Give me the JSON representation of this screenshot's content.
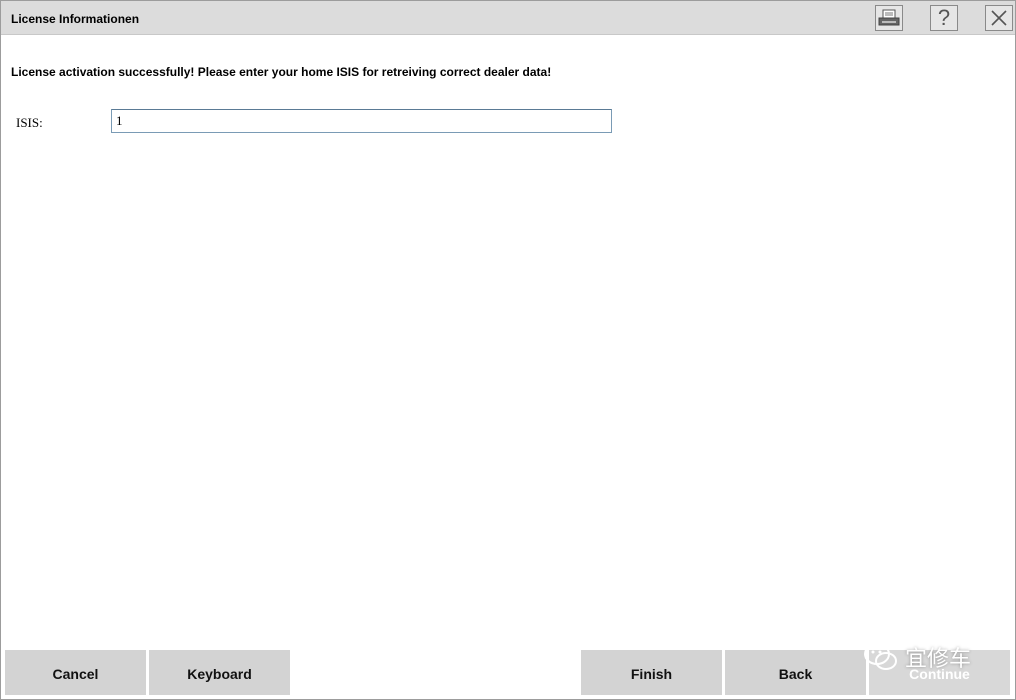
{
  "window": {
    "title": "License Informationen",
    "icons": {
      "print": "printer-icon",
      "help": "help-icon",
      "close": "close-icon"
    },
    "help_glyph": "?"
  },
  "main": {
    "message": "License activation successfully! Please enter your home ISIS for retreiving correct dealer data!",
    "isis_label": "ISIS:",
    "isis_value": "1"
  },
  "footer": {
    "cancel_label": "Cancel",
    "keyboard_label": "Keyboard",
    "finish_label": "Finish",
    "back_label": "Back",
    "continue_label": "Continue"
  },
  "watermark": {
    "text": "宜修车",
    "icon": "wechat-icon"
  },
  "colors": {
    "titlebar": "#dcdcdc",
    "button": "#d3d3d3",
    "input_border": "#7a9bb5"
  }
}
